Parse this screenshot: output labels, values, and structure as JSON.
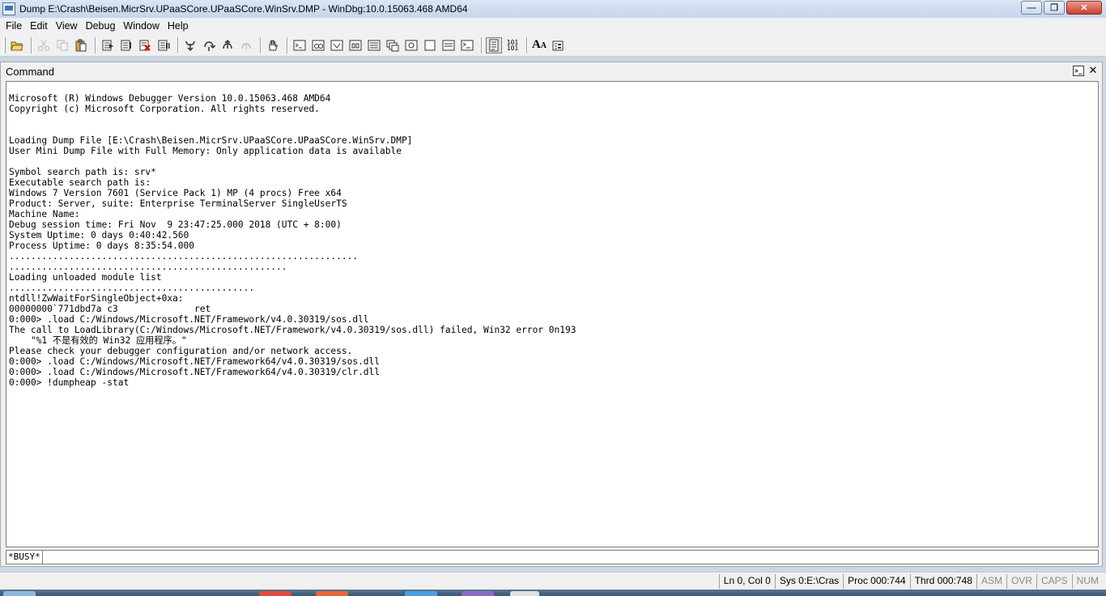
{
  "window": {
    "title": "Dump E:\\Crash\\Beisen.MicrSrv.UPaaSCore.UPaaSCore.WinSrv.DMP - WinDbg:10.0.15063.468 AMD64",
    "minimize_icon": "minimize-icon",
    "maximize_icon": "restore-icon",
    "close_glyph": "✕",
    "minimize_glyph": "—",
    "restore_glyph": "❐"
  },
  "menu": {
    "items": [
      "File",
      "Edit",
      "View",
      "Debug",
      "Window",
      "Help"
    ]
  },
  "toolbar": {
    "icons": [
      "open-icon",
      "cut-icon",
      "copy-icon",
      "paste-icon",
      "go-icon",
      "restart-icon",
      "stop-debugging-icon",
      "break-icon",
      "step-into-icon",
      "step-over-icon",
      "step-out-icon",
      "run-to-cursor-icon",
      "hand-icon",
      "command-icon",
      "watch-icon",
      "locals-icon",
      "registers-icon",
      "memory-icon",
      "call-stack-icon",
      "disassembly-icon",
      "scratch-pad-icon",
      "processes-threads-icon",
      "source-mode-icon",
      "hex-icon",
      "font-icon",
      "options-icon"
    ],
    "hex_label_top": "101",
    "hex_label_bottom": "101",
    "font_label": "A"
  },
  "command_window": {
    "title": "Command",
    "dock_icon_text": ">_",
    "close_glyph": "✕",
    "output_lines": [
      "Microsoft (R) Windows Debugger Version 10.0.15063.468 AMD64",
      "Copyright (c) Microsoft Corporation. All rights reserved.",
      "",
      "",
      "Loading Dump File [E:\\Crash\\Beisen.MicrSrv.UPaaSCore.UPaaSCore.WinSrv.DMP]",
      "User Mini Dump File with Full Memory: Only application data is available",
      "",
      "Symbol search path is: srv*",
      "Executable search path is:",
      "Windows 7 Version 7601 (Service Pack 1) MP (4 procs) Free x64",
      "Product: Server, suite: Enterprise TerminalServer SingleUserTS",
      "Machine Name:",
      "Debug session time: Fri Nov  9 23:47:25.000 2018 (UTC + 8:00)",
      "System Uptime: 0 days 0:40:42.560",
      "Process Uptime: 0 days 8:35:54.000",
      "................................................................",
      "...................................................",
      "Loading unloaded module list",
      ".............................................",
      "ntdll!ZwWaitForSingleObject+0xa:",
      "00000000`771dbd7a c3              ret",
      "0:000> .load C:/Windows/Microsoft.NET/Framework/v4.0.30319/sos.dll",
      "The call to LoadLibrary(C:/Windows/Microsoft.NET/Framework/v4.0.30319/sos.dll) failed, Win32 error 0n193",
      "    \"%1 不是有效的 Win32 应用程序。\"",
      "Please check your debugger configuration and/or network access.",
      "0:000> .load C:/Windows/Microsoft.NET/Framework64/v4.0.30319/sos.dll",
      "0:000> .load C:/Windows/Microsoft.NET/Framework64/v4.0.30319/clr.dll",
      "0:000> !dumpheap -stat"
    ],
    "prompt": "*BUSY*",
    "input_value": ""
  },
  "statusbar": {
    "ln_col": "Ln 0, Col 0",
    "sys": "Sys 0:E:\\Cras",
    "proc": "Proc 000:744",
    "thrd": "Thrd 000:748",
    "asm": "ASM",
    "ovr": "OVR",
    "caps": "CAPS",
    "num": "NUM"
  },
  "colors": {
    "titlebar": "#c5d5ea",
    "chrome": "#f0f0f0",
    "output_bg": "#ffffff",
    "taskbar": "#3a5674"
  }
}
